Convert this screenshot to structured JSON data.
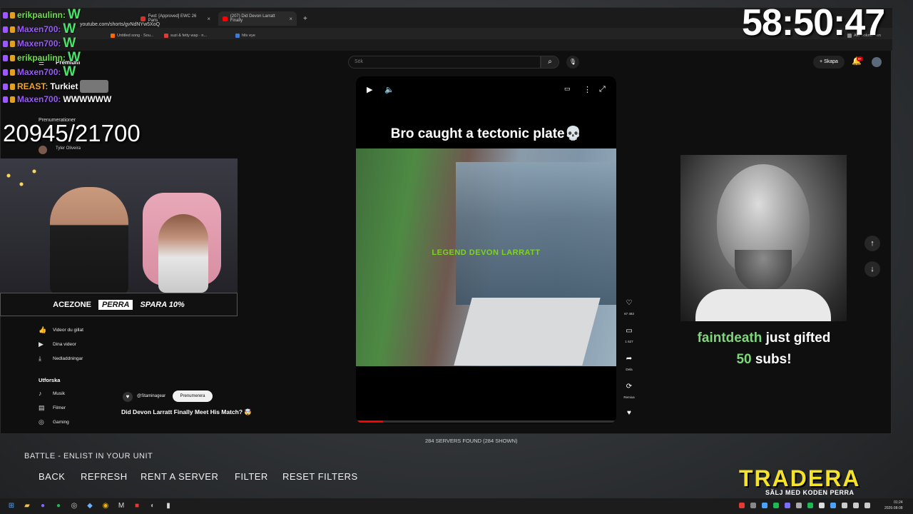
{
  "overlay": {
    "timer": "58:50:47",
    "sub_counter": "20945/21700",
    "chat": [
      {
        "user": "erikpaulinn:",
        "user_color": "#6ee04a",
        "msg": "W"
      },
      {
        "user": "Maxen700:",
        "user_color": "#9b59ff",
        "msg": "W"
      },
      {
        "user": "Maxen700:",
        "user_color": "#9b59ff",
        "msg": "W"
      },
      {
        "user": "erikpaulinn:",
        "user_color": "#6ee04a",
        "msg": "W"
      },
      {
        "user": "Maxen700:",
        "user_color": "#9b59ff",
        "msg": "W"
      },
      {
        "user": "REAST:",
        "user_color": "#f5a623",
        "msg": "Turkiet"
      },
      {
        "user": "Maxen700:",
        "user_color": "#9b59ff",
        "msg": "WWWWWW"
      }
    ],
    "gift_alert": {
      "user": "faintdeath",
      "text1": "just gifted",
      "count": "50",
      "text2": "subs!"
    },
    "webcam_bar": {
      "brand": "ACEZONE",
      "code": "PERRA",
      "offer": "SPARA 10%"
    },
    "sponsor": {
      "name": "TRADERA",
      "tagline": "SÄLJ MED KODEN PERRA"
    }
  },
  "browser": {
    "tabs": [
      {
        "label": "Fwd: [Approved] EWC 26 Paris",
        "color": "#d93025"
      },
      {
        "label": "(207) Did Devon Larratt Finally",
        "color": "#ff0000"
      }
    ],
    "url": "youtube.com/shorts/gvNdNYw5XoQ",
    "bookmarks": [
      {
        "label": "Untitled song · Sou...",
        "color": "#ff6a00"
      },
      {
        "label": "suzi & fetty wap · n...",
        "color": "#e53935"
      },
      {
        "label": "hltv eye",
        "color": "#3a7bd5"
      }
    ],
    "bookmarks_right": "Alla bokmärken"
  },
  "youtube": {
    "search_placeholder": "Sök",
    "create_label": "Skapa",
    "notif_count": "9+",
    "premium_label": "Premium",
    "subs_header": "Prenumerationer",
    "sub_channel": "Tyler Oliveira",
    "sidebar": [
      {
        "label": "Videor du gillat",
        "icon": "thumb-up-icon"
      },
      {
        "label": "Dina videor",
        "icon": "play-box-icon"
      },
      {
        "label": "Nedladdningar",
        "icon": "download-icon"
      }
    ],
    "explore_header": "Utforska",
    "explore": [
      {
        "label": "Musik",
        "icon": "music-note-icon"
      },
      {
        "label": "Filmer",
        "icon": "film-icon"
      },
      {
        "label": "Gaming",
        "icon": "gamepad-icon"
      }
    ],
    "short": {
      "overlay_title": "Bro caught a tectonic plate💀",
      "legend_caption": "LEGEND DEVON LARRATT",
      "channel": "@Staminagear",
      "subscribe_label": "Prenumerera",
      "title": "Did Devon Larratt Finally Meet His Match? 🤯",
      "progress": 0.1
    },
    "actions": {
      "likes": "67 483",
      "comments": "1 627",
      "share_label": "Dela",
      "remix_label": "Remixa"
    }
  },
  "game": {
    "battle_text": "BATTLE - ENLIST IN YOUR UNIT",
    "servers_found": "284 SERVERS FOUND (284 SHOWN)",
    "buttons": {
      "back": "BACK",
      "refresh": "REFRESH",
      "rent": "RENT A SERVER",
      "filter": "FILTER",
      "reset": "RESET FILTERS"
    }
  },
  "taskbar": {
    "time": "01:24",
    "date": "2026-08-08"
  }
}
